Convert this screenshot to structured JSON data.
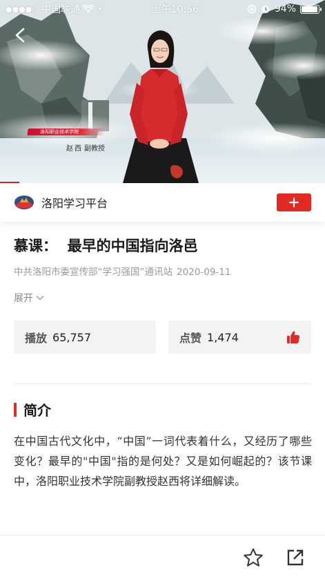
{
  "status_bar": {
    "carrier": "中国联通",
    "time": "上午10:56",
    "battery": "94%",
    "battery_level": 0.94
  },
  "video": {
    "caption_org": "洛阳职业技术学院",
    "caption_name": "赵西",
    "caption_title": "副教授",
    "progress": 0.06
  },
  "platform": {
    "name": "洛阳学习平台",
    "follow_icon": "plus-icon"
  },
  "article": {
    "title": "慕课：  最早的中国指向洛邑",
    "source": "中共洛阳市委宣传部“学习强国”通讯站",
    "date": "2020-09-11",
    "expand_label": "展开"
  },
  "stats": {
    "plays_label": "播放",
    "plays_value": "65,757",
    "likes_label": "点赞",
    "likes_value": "1,474"
  },
  "intro": {
    "heading": "简介",
    "body": "在中国古代文化中，“中国”一词代表着什么，又经历了哪些变化？最早的\"中国\"指的是何处？又是如何崛起的？该节课中，洛阳职业技术学院副教授赵西将详细解读。"
  },
  "colors": {
    "accent": "#e02a22",
    "stat_bg": "#f2f3f5"
  }
}
